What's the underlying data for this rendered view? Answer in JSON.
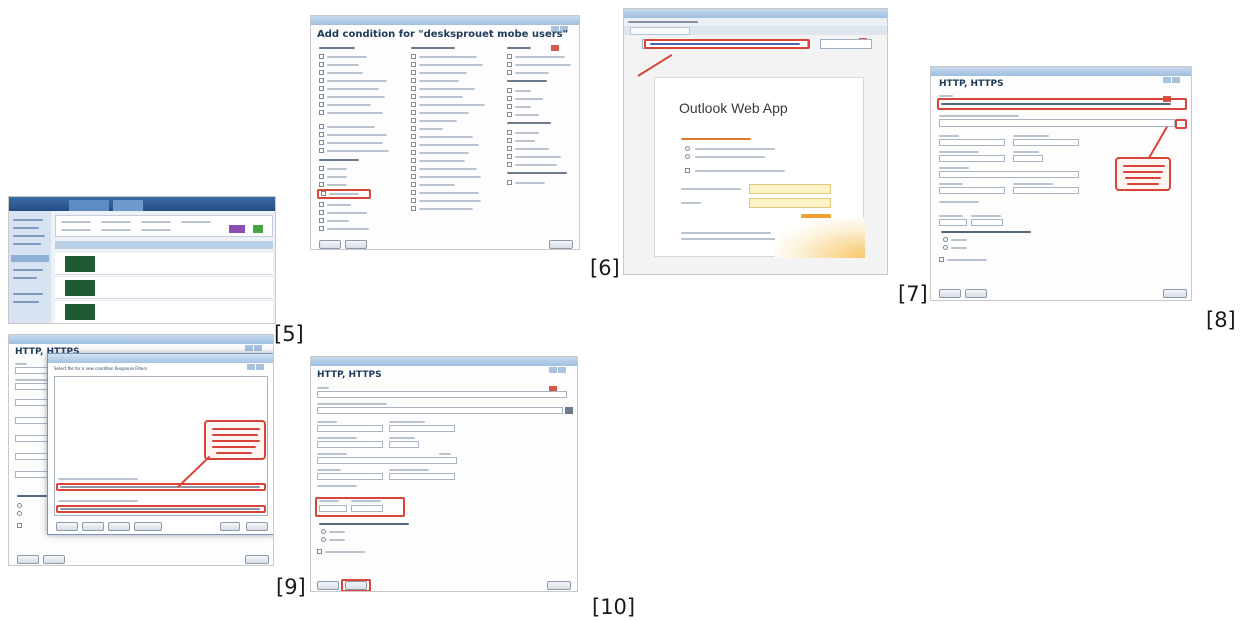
{
  "figure_labels": {
    "l5": "[5]",
    "l6": "[6]",
    "l7": "[7]",
    "l8": "[8]",
    "l9": "[9]",
    "l10": "[10]"
  },
  "screens": {
    "s6": {
      "title": "Add condition for \"desksprouet mobe users\""
    },
    "s7": {
      "app_title": "Outlook Web App"
    },
    "s8": {
      "title": "HTTP, HTTPS"
    },
    "s9": {
      "title": "HTTP, HTTPS",
      "dialog_title": "Select file for a new condition Response Filters"
    },
    "s10": {
      "title": "HTTP, HTTPS"
    }
  },
  "colors": {
    "highlight": "#d8443a",
    "title_bar": "#9fbfe0",
    "heading": "#1e3a5a",
    "outlook_orange": "#f0a030",
    "dark_green": "#1f5a32"
  }
}
